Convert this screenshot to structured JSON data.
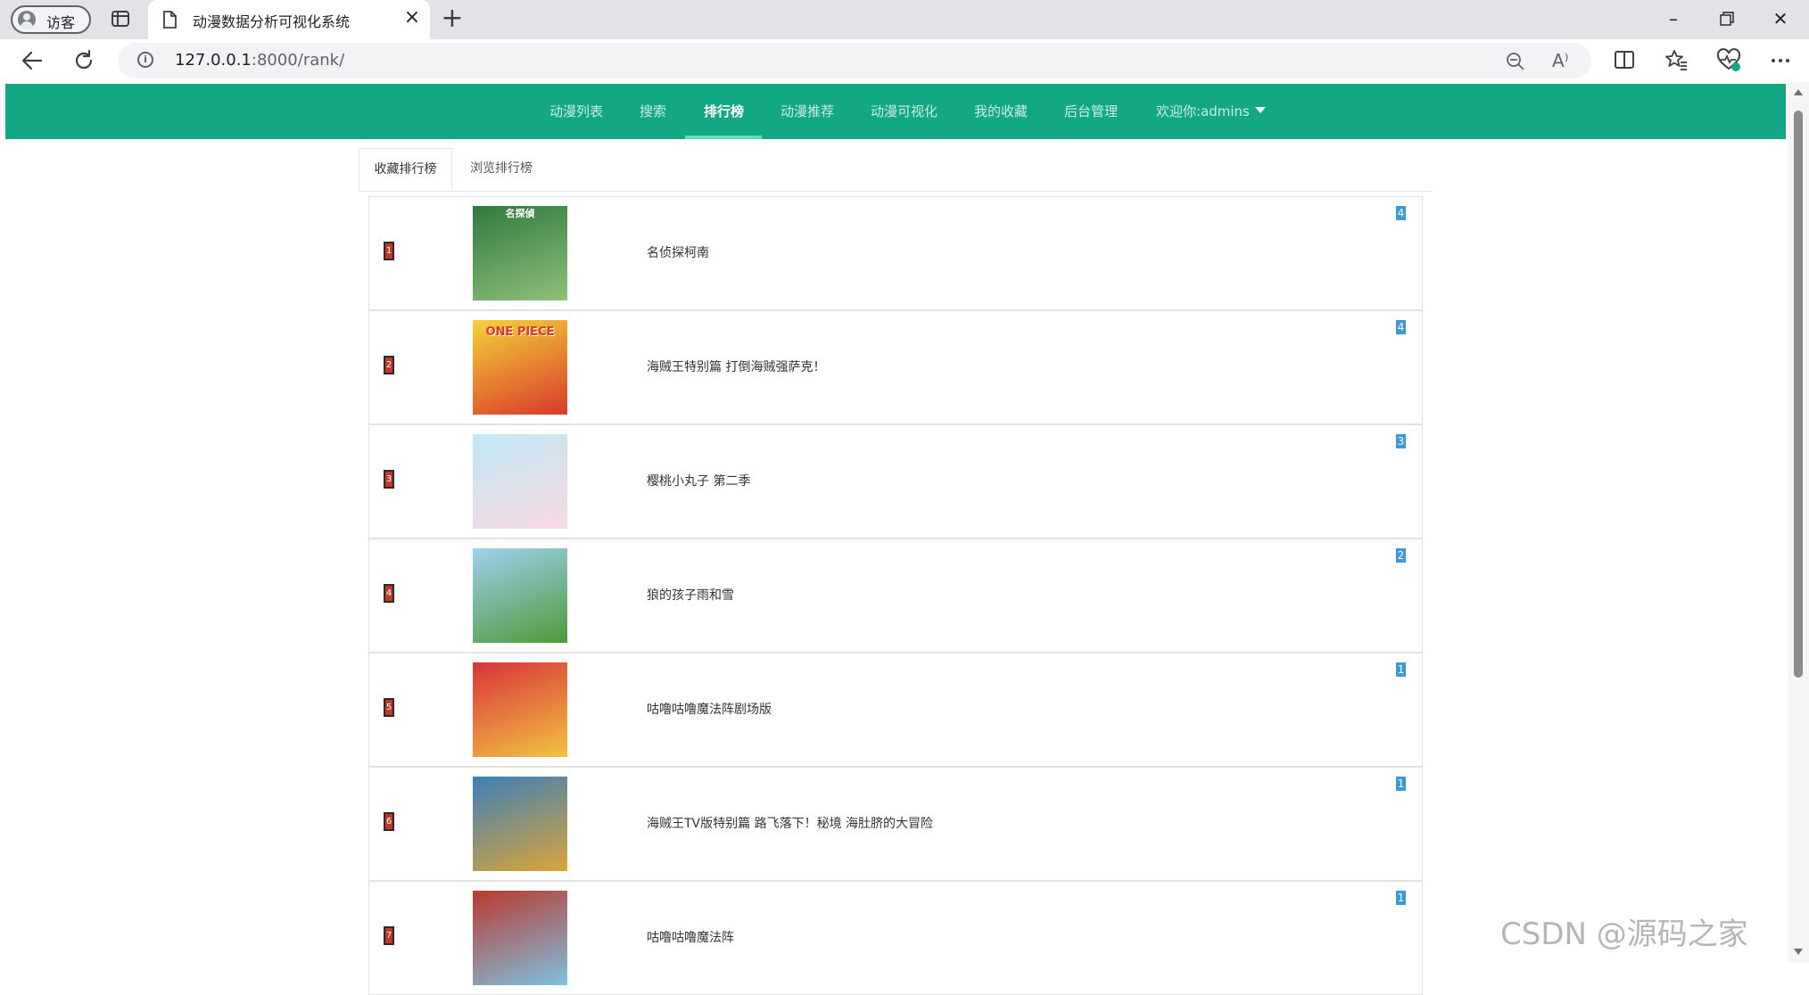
{
  "browser": {
    "profile_label": "访客",
    "tab_title": "动漫数据分析可视化系统",
    "url_host": "127.0.0.1",
    "url_rest": ":8000/rank/",
    "read_aloud_glyph": "A⁾"
  },
  "navbar": {
    "items": [
      {
        "label": "动漫列表"
      },
      {
        "label": "搜索"
      },
      {
        "label": "排行榜",
        "active": true
      },
      {
        "label": "动漫推荐"
      },
      {
        "label": "动漫可视化"
      },
      {
        "label": "我的收藏"
      },
      {
        "label": "后台管理"
      },
      {
        "label": "欢迎你:admins",
        "dropdown": true
      }
    ]
  },
  "tabs": [
    {
      "label": "收藏排行榜",
      "active": true
    },
    {
      "label": "浏览排行榜"
    }
  ],
  "rows": [
    {
      "rank": "1",
      "title": "名侦探柯南",
      "count": "4",
      "cover_colors": [
        "#2f7a3e",
        "#8fc07a"
      ],
      "cover_label": "名探偵"
    },
    {
      "rank": "2",
      "title": "海贼王特别篇 打倒海贼强萨克！",
      "count": "4",
      "cover_colors": [
        "#f4d23a",
        "#d93a2a"
      ],
      "cover_label": "ONE PIECE"
    },
    {
      "rank": "3",
      "title": "樱桃小丸子 第二季",
      "count": "3",
      "cover_colors": [
        "#bfe9f5",
        "#f7d7e1"
      ],
      "cover_label": ""
    },
    {
      "rank": "4",
      "title": "狼的孩子雨和雪",
      "count": "2",
      "cover_colors": [
        "#9fd0ee",
        "#4f9a3a"
      ],
      "cover_label": ""
    },
    {
      "rank": "5",
      "title": "咕噜咕噜魔法阵剧场版",
      "count": "1",
      "cover_colors": [
        "#d8343a",
        "#f2c242"
      ],
      "cover_label": ""
    },
    {
      "rank": "6",
      "title": "海贼王TV版特别篇 路飞落下！秘境 海肚脐的大冒险",
      "count": "1",
      "cover_colors": [
        "#3e7fb8",
        "#d9a53a"
      ],
      "cover_label": ""
    },
    {
      "rank": "7",
      "title": "咕噜咕噜魔法阵",
      "count": "1",
      "cover_colors": [
        "#b93a2f",
        "#7fc0e0"
      ],
      "cover_label": ""
    }
  ],
  "watermark": "CSDN @源码之家",
  "colors": {
    "nav_bg": "#12a886",
    "rank_badge": "#c0392b",
    "count_badge": "#3a9ad9"
  }
}
